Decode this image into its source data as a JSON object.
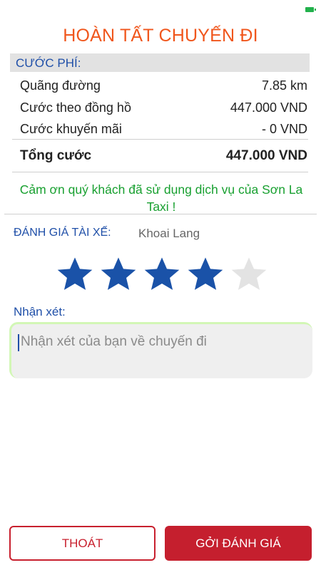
{
  "header": {
    "title": "HOÀN TẤT CHUYẾN ĐI"
  },
  "fare": {
    "section_label": "CƯỚC PHÍ:",
    "rows": [
      {
        "label": "Quãng đường",
        "value": "7.85 km"
      },
      {
        "label": "Cước theo đồng hồ",
        "value": "447.000 VND"
      },
      {
        "label": "Cước khuyến mãi",
        "value": "- 0 VND"
      }
    ],
    "total": {
      "label": "Tổng cước",
      "value": "447.000 VND"
    }
  },
  "thanks_message": "Cảm ơn quý khách đã sử dụng dịch vụ của Sơn La Taxi !",
  "rating": {
    "label": "ĐÁNH GIÁ TÀI XẾ:",
    "driver_name": "Khoai Lang",
    "value": 4,
    "max": 5,
    "filled_color": "#1a52a8",
    "empty_color": "#e3e3e3"
  },
  "comment": {
    "label": "Nhận xét:",
    "value": "",
    "placeholder": "Nhận xét của bạn về chuyến đi"
  },
  "buttons": {
    "exit_label": "THOÁT",
    "submit_label": "GỞI ĐÁNH GIÁ"
  },
  "colors": {
    "title": "#f0561c",
    "label_blue": "#1f4fa8",
    "thanks_green": "#18a030",
    "accent_red": "#c51f2e"
  }
}
